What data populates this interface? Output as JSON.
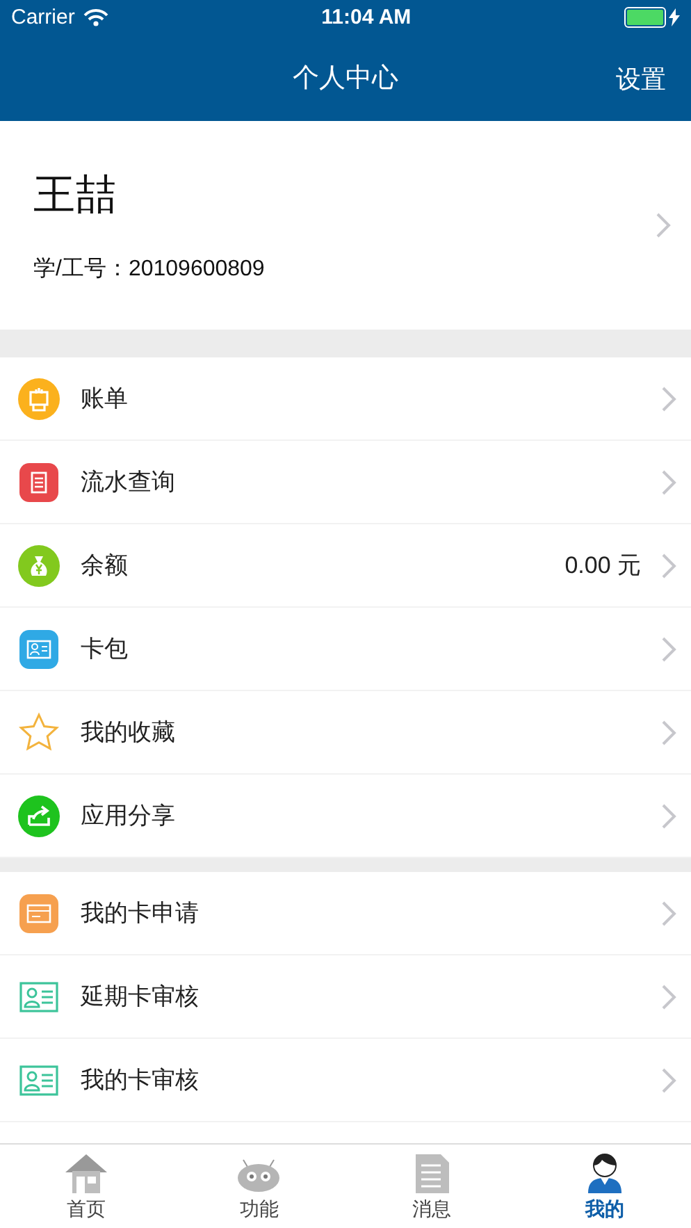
{
  "status_bar": {
    "carrier": "Carrier",
    "time": "11:04 AM"
  },
  "nav": {
    "title": "个人中心",
    "action": "设置"
  },
  "profile": {
    "name": "王喆",
    "id_line": "学/工号：20109600809"
  },
  "groups": [
    {
      "items": [
        {
          "kind": "bill",
          "label": "账单"
        },
        {
          "kind": "ledger",
          "label": "流水查询"
        },
        {
          "kind": "money",
          "label": "余额",
          "value": "0.00 元"
        },
        {
          "kind": "card",
          "label": "卡包"
        },
        {
          "kind": "star",
          "label": "我的收藏"
        },
        {
          "kind": "share",
          "label": "应用分享"
        }
      ]
    },
    {
      "items": [
        {
          "kind": "apply",
          "label": "我的卡申请"
        },
        {
          "kind": "idcard",
          "label": "延期卡审核"
        },
        {
          "kind": "idcard",
          "label": "我的卡审核"
        }
      ]
    }
  ],
  "tab_bar": [
    {
      "kind": "home",
      "label": "首页",
      "selected": false
    },
    {
      "kind": "robot",
      "label": "功能",
      "selected": false
    },
    {
      "kind": "doc",
      "label": "消息",
      "selected": false
    },
    {
      "kind": "person",
      "label": "我的",
      "selected": true
    }
  ]
}
